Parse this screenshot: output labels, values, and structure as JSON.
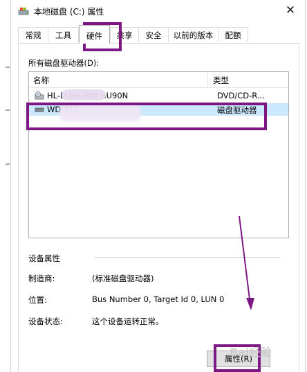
{
  "window": {
    "title": "本地磁盘 (C:) 属性",
    "close_label": "✕"
  },
  "tabs": [
    {
      "label": "常规"
    },
    {
      "label": "工具"
    },
    {
      "label": "硬件"
    },
    {
      "label": "共享"
    },
    {
      "label": "安全"
    },
    {
      "label": "以前的版本"
    },
    {
      "label": "配额"
    }
  ],
  "active_tab": "硬件",
  "drives": {
    "section_label": "所有磁盘驱动器(D):",
    "columns": {
      "name": "名称",
      "type": "类型"
    },
    "rows": [
      {
        "name": "HL-D        D+-RW GU90N",
        "type": "DVD/CD-R...",
        "icon": "dvd-drive-icon",
        "selected": false
      },
      {
        "name": "WD                    3T0",
        "type": "磁盘驱动器",
        "icon": "hard-disk-icon",
        "selected": true
      }
    ]
  },
  "device_properties": {
    "title": "设备属性",
    "manufacturer_label": "制造商:",
    "manufacturer_value": "(标准磁盘驱动器)",
    "location_label": "位置:",
    "location_value": "Bus Number 0, Target Id 0, LUN 0",
    "status_label": "设备状态:",
    "status_value": "这个设备运转正常。"
  },
  "buttons": {
    "properties_label": "属性(R)"
  },
  "watermark": "Bai经验",
  "colors": {
    "highlight": "#7d1783",
    "selection": "#cce8ff"
  }
}
